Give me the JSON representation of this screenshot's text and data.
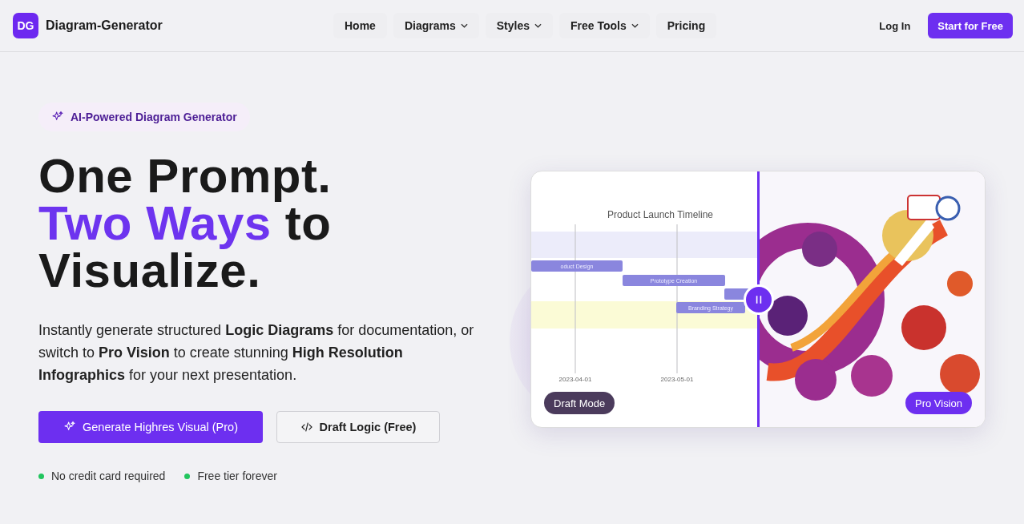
{
  "nav": {
    "logo": "DG",
    "brand": "Diagram-Generator",
    "links": [
      {
        "label": "Home",
        "dropdown": false
      },
      {
        "label": "Diagrams",
        "dropdown": true
      },
      {
        "label": "Styles",
        "dropdown": true
      },
      {
        "label": "Free Tools",
        "dropdown": true
      },
      {
        "label": "Pricing",
        "dropdown": false
      }
    ],
    "login": "Log In",
    "cta": "Start for Free"
  },
  "hero": {
    "badge": "AI-Powered Diagram Generator",
    "title_lines": [
      {
        "parts": [
          {
            "text": "One Prompt.",
            "accent": false
          }
        ]
      },
      {
        "parts": [
          {
            "text": "Two Ways",
            "accent": true
          },
          {
            "text": " to",
            "accent": false
          }
        ]
      },
      {
        "parts": [
          {
            "text": "Visualize.",
            "accent": false
          }
        ]
      }
    ],
    "description": "Instantly generate structured **Logic Diagrams** for documentation, or switch to **Pro Vision** to create stunning **High Resolution Infographics** for your next presentation.",
    "buttons": [
      {
        "label": "Generate Highres Visual (Pro)",
        "kind": "primary"
      },
      {
        "label": "Draft Logic (Free)",
        "kind": "secondary"
      }
    ],
    "checks": [
      "No credit card required",
      "Free tier forever"
    ]
  },
  "comparison": {
    "draft": {
      "label": "Draft Mode",
      "chart_title": "Product Launch Timeline",
      "bars": [
        {
          "kind": "labeled",
          "label": "oduct Design"
        },
        {
          "kind": "labeled",
          "label": "Prototype Creation"
        },
        {
          "kind": "plain"
        },
        {
          "kind": "labeled",
          "label": "Branding Strategy"
        }
      ],
      "dates": [
        "2023-04-01",
        "2023-05-01"
      ]
    },
    "pro": {
      "label": "Pro Vision",
      "kind": "picture"
    }
  }
}
